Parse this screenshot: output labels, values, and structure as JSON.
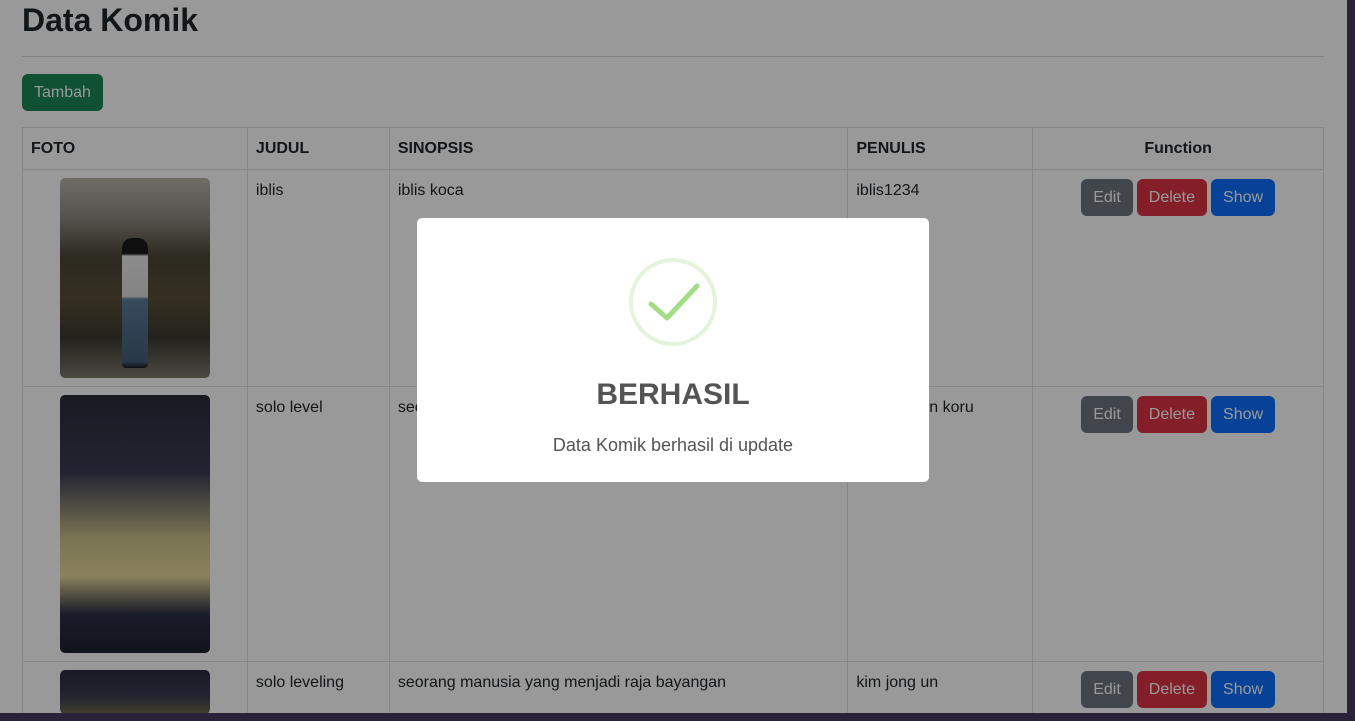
{
  "page": {
    "title": "Data Komik"
  },
  "toolbar": {
    "add_label": "Tambah"
  },
  "table": {
    "headers": {
      "foto": "FOTO",
      "judul": "JUDUL",
      "sinopsis": "SINOPSIS",
      "penulis": "PENULIS",
      "function": "Function"
    },
    "rows": [
      {
        "judul": "iblis",
        "sinopsis": "iblis koca",
        "penulis": "iblis1234"
      },
      {
        "judul": "solo level",
        "sinopsis": "seorang manusia yang menjadi raja bayangan",
        "penulis": "kim jong un koru"
      },
      {
        "judul": "solo leveling",
        "sinopsis": "seorang manusia yang menjadi raja bayangan",
        "penulis": "kim jong un"
      }
    ],
    "actions": {
      "edit": "Edit",
      "delete": "Delete",
      "show": "Show"
    }
  },
  "modal": {
    "icon": "check-icon",
    "title": "BERHASIL",
    "text": "Data Komik berhasil di update"
  },
  "colors": {
    "success": "#198754",
    "secondary": "#6c757d",
    "danger": "#dc3545",
    "primary": "#0d6efd",
    "check": "#a5dc86"
  }
}
